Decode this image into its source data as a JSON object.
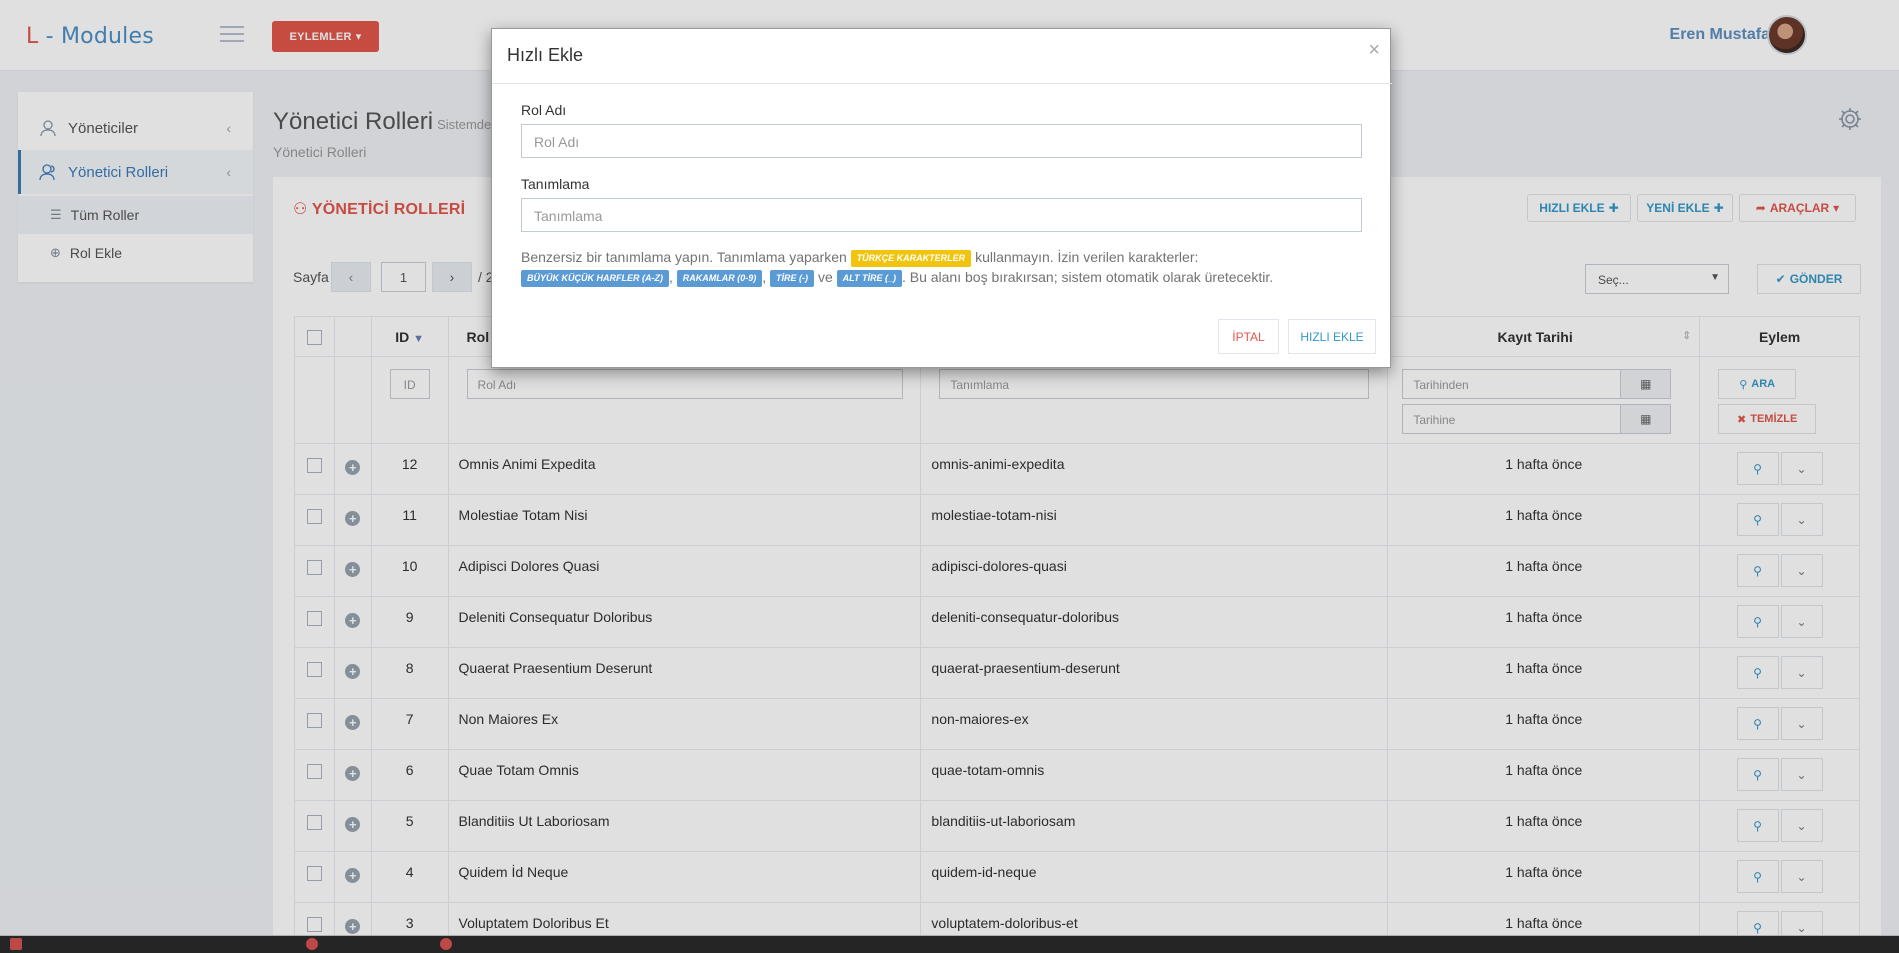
{
  "app": {
    "brand_l": "L",
    "brand_rest": " - Modules"
  },
  "header": {
    "actions_label": "EYLEMLER",
    "user_name": "Eren Mustafa"
  },
  "sidebar": {
    "items": [
      {
        "label": "Yöneticiler"
      },
      {
        "label": "Yönetici Rolleri"
      }
    ],
    "subitems": [
      {
        "label": "Tüm Roller"
      },
      {
        "label": "Rol Ekle"
      }
    ]
  },
  "page": {
    "title": "Yönetici Rolleri",
    "subtitle": "Sistemde",
    "breadcrumb": "Yönetici Rolleri"
  },
  "portlet": {
    "title": "YÖNETİCİ ROLLERİ",
    "quick_add": "HIZLI EKLE",
    "new_add": "YENİ EKLE",
    "tools": "ARAÇLAR",
    "page_label": "Sayfa",
    "page_value": "1",
    "page_total": "/ 2",
    "select_placeholder": "Seç...",
    "send": "GÖNDER"
  },
  "table": {
    "headers": {
      "id": "ID",
      "role_name": "Rol Adı",
      "created": "Kayıt Tarihi",
      "action": "Eylem"
    },
    "filters": {
      "id": "ID",
      "role_name": "Rol Adı",
      "description": "Tanımlama",
      "date_from": "Tarihinden",
      "date_to": "Tarihine",
      "search": "ARA",
      "clear": "TEMİZLE"
    },
    "rows": [
      {
        "id": "12",
        "name": "Omnis Animi Expedita",
        "slug": "omnis-animi-expedita",
        "date": "1 hafta önce"
      },
      {
        "id": "11",
        "name": "Molestiae Totam Nisi",
        "slug": "molestiae-totam-nisi",
        "date": "1 hafta önce"
      },
      {
        "id": "10",
        "name": "Adipisci Dolores Quasi",
        "slug": "adipisci-dolores-quasi",
        "date": "1 hafta önce"
      },
      {
        "id": "9",
        "name": "Deleniti Consequatur Doloribus",
        "slug": "deleniti-consequatur-doloribus",
        "date": "1 hafta önce"
      },
      {
        "id": "8",
        "name": "Quaerat Praesentium Deserunt",
        "slug": "quaerat-praesentium-deserunt",
        "date": "1 hafta önce"
      },
      {
        "id": "7",
        "name": "Non Maiores Ex",
        "slug": "non-maiores-ex",
        "date": "1 hafta önce"
      },
      {
        "id": "6",
        "name": "Quae Totam Omnis",
        "slug": "quae-totam-omnis",
        "date": "1 hafta önce"
      },
      {
        "id": "5",
        "name": "Blanditiis Ut Laboriosam",
        "slug": "blanditiis-ut-laboriosam",
        "date": "1 hafta önce"
      },
      {
        "id": "4",
        "name": "Quidem İd Neque",
        "slug": "quidem-id-neque",
        "date": "1 hafta önce"
      },
      {
        "id": "3",
        "name": "Voluptatem Doloribus Et",
        "slug": "voluptatem-doloribus-et",
        "date": "1 hafta önce"
      }
    ]
  },
  "modal": {
    "title": "Hızlı Ekle",
    "close": "×",
    "role_label": "Rol Adı",
    "role_placeholder": "Rol Adı",
    "desc_label": "Tanımlama",
    "desc_placeholder": "Tanımlama",
    "help_1": "Benzersiz bir tanımlama yapın. Tanımlama yaparken",
    "badge_turkish": "TÜRKÇE KARAKTERLER",
    "help_2": "kullanmayın. İzin verilen karakterler:",
    "badge_letters": "BÜYÜK KÜÇÜK HARFLER (A-Z)",
    "badge_numbers": "RAKAMLAR (0-9)",
    "badge_dash": "TİRE (-)",
    "and": "ve",
    "badge_underscore": "ALT TİRE (_)",
    "help_3": ". Bu alanı boş bırakırsan; sistem otomatik olarak üretecektir.",
    "cancel": "İPTAL",
    "submit": "HIZLI EKLE"
  },
  "colors": {
    "accent_red": "#e2574c",
    "accent_blue": "#3598c9",
    "brand_blue": "#4a90c6",
    "label_yellow": "#f1c40f",
    "label_blue": "#5b9bd5"
  },
  "icons": [
    "menu-icon",
    "user-icon",
    "users-icon",
    "list-icon",
    "plus-circle-icon",
    "gear-icon",
    "search-icon",
    "times-icon",
    "check-icon",
    "calendar-icon",
    "share-icon",
    "chevron-down-icon"
  ]
}
